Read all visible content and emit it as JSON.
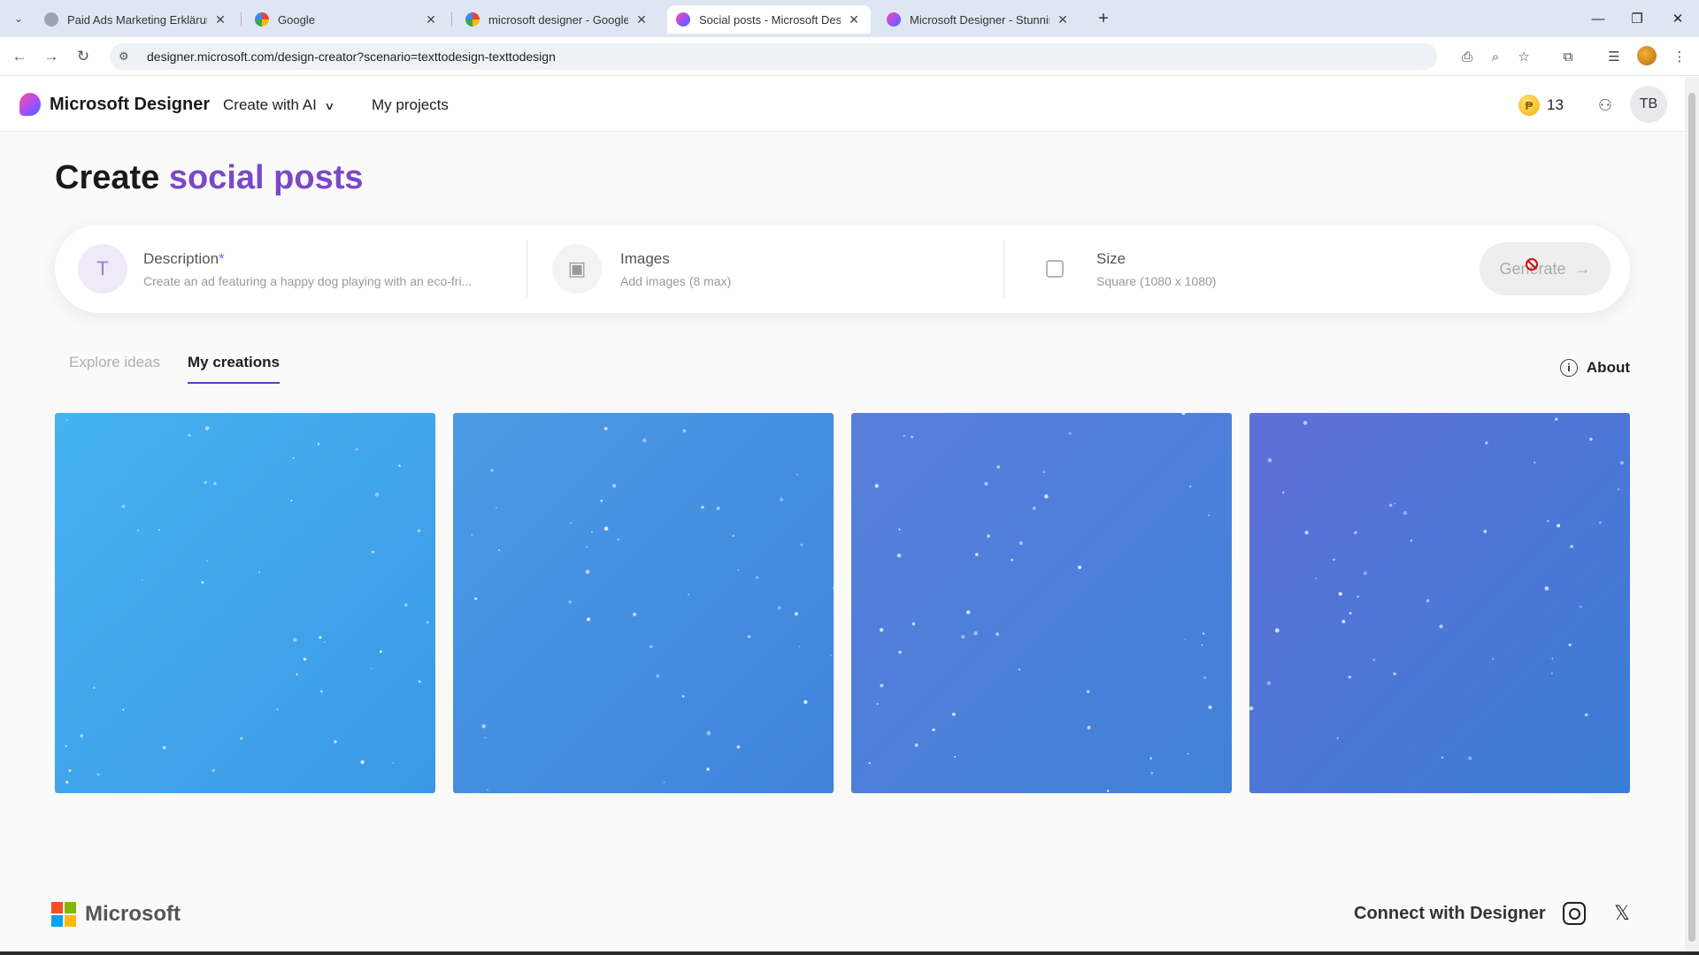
{
  "browser": {
    "tabs": [
      {
        "title": "Paid Ads Marketing Erklärung",
        "active": false,
        "favicon": "globe-icon"
      },
      {
        "title": "Google",
        "active": false,
        "favicon": "google-icon"
      },
      {
        "title": "microsoft designer - Google Se",
        "active": false,
        "favicon": "google-icon"
      },
      {
        "title": "Social posts - Microsoft Design",
        "active": true,
        "favicon": "designer-icon"
      },
      {
        "title": "Microsoft Designer - Stunning d",
        "active": false,
        "favicon": "designer-icon"
      }
    ],
    "url": "designer.microsoft.com/design-creator?scenario=texttodesign-texttodesign"
  },
  "header": {
    "brand": "Microsoft Designer",
    "create_with_ai": "Create with AI",
    "my_projects": "My projects",
    "coin_symbol": "₱",
    "coin_count": "13",
    "avatar_initials": "TB"
  },
  "main": {
    "title_prefix": "Create",
    "title_accent": "social posts",
    "prompt": {
      "description_label": "Description",
      "description_required": "*",
      "description_placeholder": "Create an ad featuring a happy dog playing with an eco-fri...",
      "images_label": "Images",
      "images_sub": "Add images (8 max)",
      "size_label": "Size",
      "size_value": "Square (1080 x 1080)",
      "generate_label": "Generate"
    },
    "tabs": [
      {
        "label": "Explore ideas",
        "active": false
      },
      {
        "label": "My creations",
        "active": true
      }
    ],
    "about_label": "About"
  },
  "footer": {
    "microsoft": "Microsoft",
    "connect": "Connect with Designer"
  },
  "colors": {
    "accent_purple": "#7a48c9",
    "tab_underline": "#5b3fbf",
    "card_gradients": [
      [
        "#45b3f1",
        "#3c98e6"
      ],
      [
        "#4a9be5",
        "#4083dc"
      ],
      [
        "#5a7ddc",
        "#3f82d8"
      ],
      [
        "#5f6fd8",
        "#3a7ed6"
      ]
    ]
  }
}
